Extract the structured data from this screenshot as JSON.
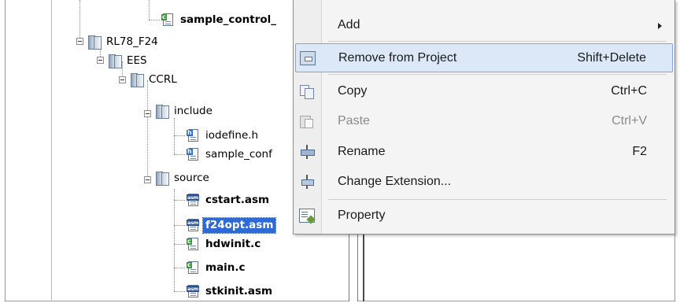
{
  "tree": {
    "nodes": [
      {
        "label": "sample_control_",
        "icon": "c-source-file-icon"
      },
      {
        "label": "RL78_F24",
        "icon": "folder-icon"
      },
      {
        "label": "EES",
        "icon": "folder-icon"
      },
      {
        "label": "CCRL",
        "icon": "folder-icon"
      },
      {
        "label": "include",
        "icon": "folder-icon"
      },
      {
        "label": "iodefine.h",
        "icon": "h-header-file-icon"
      },
      {
        "label": "sample_conf",
        "icon": "h-header-file-icon"
      },
      {
        "label": "source",
        "icon": "folder-icon"
      },
      {
        "label": "cstart.asm",
        "icon": "asm-file-icon"
      },
      {
        "label": "f24opt.asm",
        "icon": "asm-file-icon",
        "selected": true
      },
      {
        "label": "hdwinit.c",
        "icon": "c-source-file-icon"
      },
      {
        "label": "main.c",
        "icon": "c-source-file-icon"
      },
      {
        "label": "stkinit.asm",
        "icon": "asm-file-icon"
      }
    ],
    "icon_tags": {
      "c": "c",
      "h": "h",
      "asm": "asm"
    }
  },
  "context_menu": {
    "items": [
      {
        "label": "Add",
        "shortcut": "",
        "icon": "none",
        "submenu": true
      },
      {
        "label": "Remove from Project",
        "shortcut": "Shift+Delete",
        "icon": "remove-from-project-icon",
        "highlighted": true
      },
      {
        "label": "Copy",
        "shortcut": "Ctrl+C",
        "icon": "copy-icon"
      },
      {
        "label": "Paste",
        "shortcut": "Ctrl+V",
        "icon": "paste-icon",
        "disabled": true
      },
      {
        "label": "Rename",
        "shortcut": "F2",
        "icon": "rename-icon"
      },
      {
        "label": "Change Extension...",
        "shortcut": "",
        "icon": "change-extension-icon"
      },
      {
        "label": "Property",
        "shortcut": "",
        "icon": "property-icon"
      }
    ]
  },
  "colors": {
    "selection": "#2e6ad6",
    "menu_highlight": "#dce8f7",
    "menu_background": "#f4f4f4"
  }
}
